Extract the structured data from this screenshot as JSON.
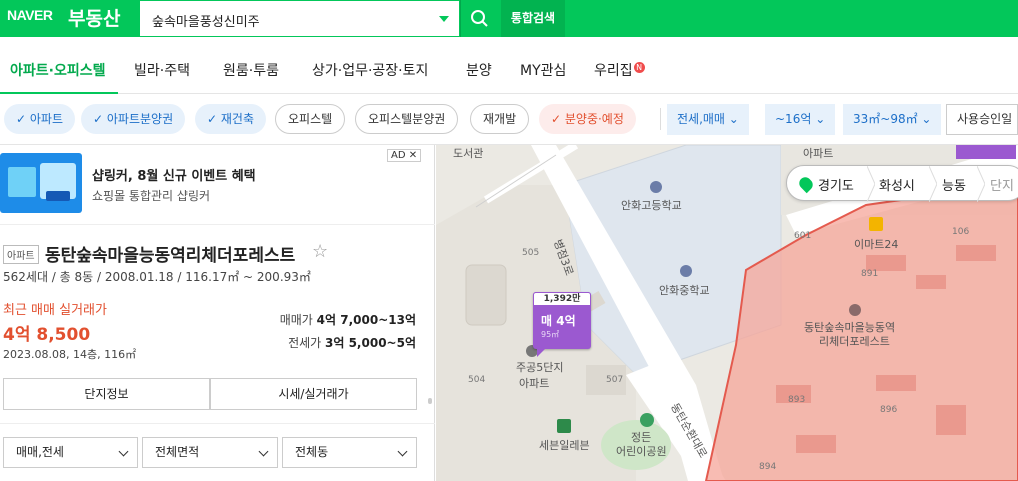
{
  "topbar": {
    "logo": "NAVER",
    "service": "부동산",
    "search_value": "숲속마을풍성신미주",
    "total_search": "통합검색"
  },
  "nav": {
    "items": [
      "아파트·오피스텔",
      "빌라·주택",
      "원룸·투룸",
      "상가·업무·공장·토지",
      "분양",
      "MY관심",
      "우리집"
    ],
    "badge": "N"
  },
  "filters": {
    "chips": [
      "아파트",
      "아파트분양권",
      "재건축",
      "오피스텔",
      "오피스텔분양권",
      "재개발",
      "분양중·예정"
    ],
    "drops": [
      "전세,매매",
      "~16억",
      "33㎡~98㎡",
      "사용승인일"
    ]
  },
  "ad": {
    "title": "샵링커, 8월 신규 이벤트 혜택",
    "desc": "쇼핑몰 통합관리 샵링커",
    "tag": "AD",
    "close": "✕"
  },
  "complex": {
    "type": "아파트",
    "name": "동탄숲속마을능동역리체더포레스트",
    "meta": "562세대 / 총 8동 / 2008.01.18 / 116.17㎡ ~ 200.93㎡",
    "recent_label": "최근 매매 실거래가",
    "recent_price": "4억 8,500",
    "recent_date": "2023.08.08, 14층, 116㎡",
    "sale_label": "매매가",
    "sale_value": "4억 7,000~13억",
    "jeonse_label": "전세가",
    "jeonse_value": "3억 5,000~5억",
    "tabs": [
      "단지정보",
      "시세/실거래가"
    ],
    "selects": [
      "매매,전세",
      "전체면적",
      "전체동"
    ]
  },
  "map": {
    "breadcrumb": [
      "경기도",
      "화성시",
      "능동",
      "단지"
    ],
    "labels": {
      "school_high": "안화고등학교",
      "school_mid": "안화중학교",
      "complex": "동탄숲속마을능동역\n리체더포레스트",
      "complex_line1": "동탄숲속마을능동역",
      "complex_line2": "리체더포레스트",
      "emart": "이마트24",
      "apt5_line1": "주공5단지",
      "apt5_line2": "아파트",
      "seven": "세븐일레븐",
      "park_line1": "정든",
      "park_line2": "어린이공원",
      "road1": "병점3로",
      "road2": "동탄순환대로",
      "top": "도서관",
      "top2": "아파트"
    },
    "numbers": [
      "505",
      "504",
      "507",
      "601",
      "891",
      "893",
      "894",
      "896",
      "106"
    ],
    "pin": {
      "count": "1,392만",
      "price": "매 4억",
      "area": "95㎡"
    }
  },
  "colors": {
    "brand": "#03c75a",
    "accent_blue": "#1d6fc8",
    "accent_red": "#e2502f",
    "pin": "#9b59d0"
  }
}
